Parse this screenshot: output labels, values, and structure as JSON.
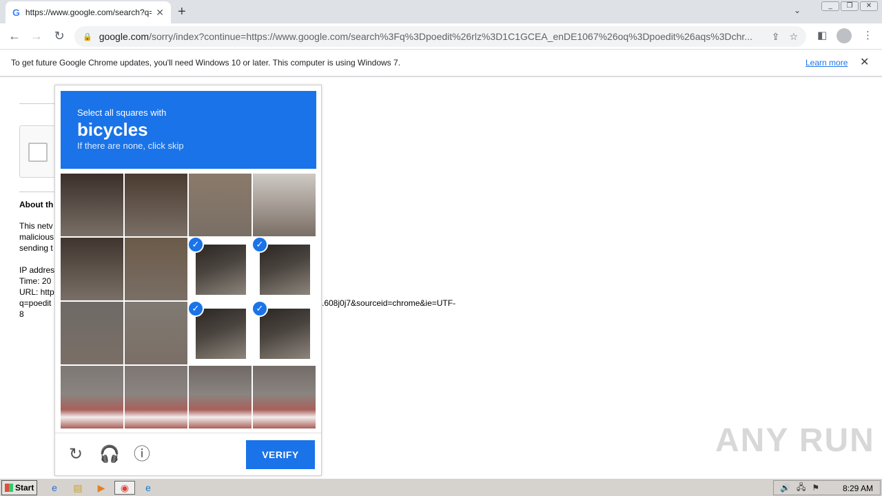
{
  "browser": {
    "tab_title": "https://www.google.com/search?q=",
    "url_host": "google.com",
    "url_path": "/sorry/index?continue=https://www.google.com/search%3Fq%3Dpoedit%26rlz%3D1C1GCEA_enDE1067%26oq%3Dpoedit%26aqs%3Dchr..."
  },
  "infobar": {
    "message": "To get future Google Chrome updates, you'll need Windows 10 or later. This computer is using Windows 7.",
    "learn_more": "Learn more"
  },
  "page": {
    "about": "About th",
    "lines": [
      "This netv",
      "malicious",
      "sending t",
      "IP addres",
      "Time: 20",
      "URL: http",
      "q=poedit",
      "8"
    ],
    "url_tail": ".608j0j7&sourceid=chrome&ie=UTF-"
  },
  "captcha": {
    "instruction": "Select all squares with",
    "target": "bicycles",
    "hint": "If there are none, click skip",
    "verify_label": "VERIFY",
    "selected_tiles": [
      [
        1,
        2
      ],
      [
        1,
        3
      ],
      [
        2,
        2
      ],
      [
        2,
        3
      ]
    ]
  },
  "watermark": "ANY RUN",
  "taskbar": {
    "start_label": "Start",
    "clock": "8:29 AM"
  }
}
